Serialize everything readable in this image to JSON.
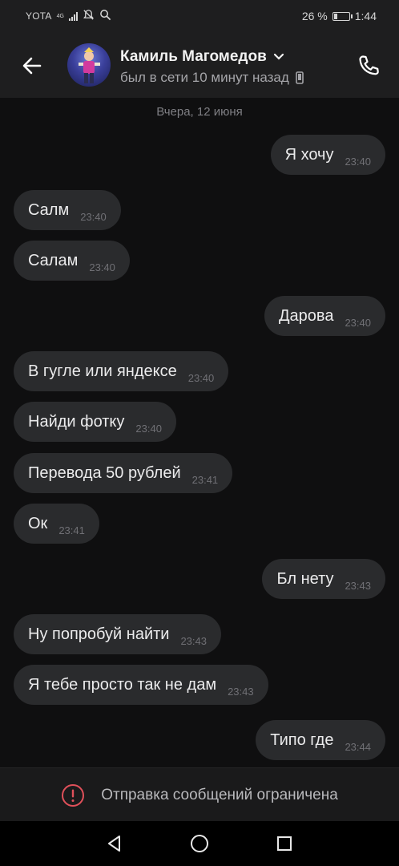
{
  "status_bar": {
    "carrier": "YOTA",
    "network": "4G",
    "battery_percent": "26 %",
    "battery_level": 0.26,
    "time": "1:44"
  },
  "header": {
    "contact_name": "Камиль Магомедов",
    "last_seen": "был в сети 10 минут назад"
  },
  "date_separator": "Вчера, 12 июня",
  "messages": [
    {
      "dir": "out",
      "text": "Я хочу",
      "time": "23:40"
    },
    {
      "dir": "in",
      "text": "Салм",
      "time": "23:40"
    },
    {
      "dir": "in",
      "text": "Салам",
      "time": "23:40"
    },
    {
      "dir": "out",
      "text": "Дарова",
      "time": "23:40"
    },
    {
      "dir": "in",
      "text": "В гугле или яндексе",
      "time": "23:40"
    },
    {
      "dir": "in",
      "text": "Найди фотку",
      "time": "23:40"
    },
    {
      "dir": "in",
      "text": "Перевода 50 рублей",
      "time": "23:41"
    },
    {
      "dir": "in",
      "text": "Ок",
      "time": "23:41"
    },
    {
      "dir": "out",
      "text": "Бл нету",
      "time": "23:43"
    },
    {
      "dir": "in",
      "text": "Ну попробуй найти",
      "time": "23:43"
    },
    {
      "dir": "in",
      "text": "Я тебе просто так не дам",
      "time": "23:43"
    },
    {
      "dir": "out",
      "text": "Типо где",
      "time": "23:44"
    }
  ],
  "footer": {
    "restricted_text": "Отправка сообщений ограничена"
  },
  "colors": {
    "background": "#0f0f10",
    "bubble": "#2a2b2d",
    "warning": "#e0505a"
  },
  "icons": {
    "back": "arrow-left-icon",
    "call": "phone-icon",
    "device": "mobile-device-icon",
    "warning": "alert-circle-icon"
  }
}
